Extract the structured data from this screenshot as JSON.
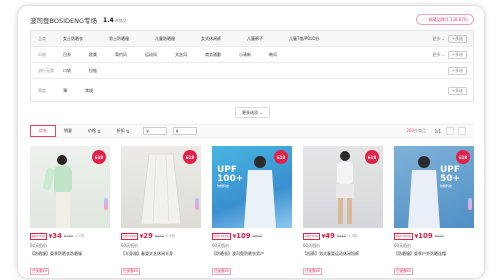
{
  "header": {
    "store_name": "波司登BOSIDENG专场",
    "count": "1.4",
    "count_unit": "件商品",
    "fav_label": "收藏品牌(1,338,876)"
  },
  "filters": [
    {
      "label": "品类",
      "options": [
        "女士防晒衣",
        "男士防晒服",
        "儿童防晒服",
        "女式休闲裤",
        "儿童裤子",
        "儿童T恤/POLO衫"
      ],
      "more": "更多",
      "multi": "多选"
    },
    {
      "label": "风格",
      "options": [
        "日系",
        "欧美",
        "简约风",
        "运动风",
        "文艺风",
        "商务通勤",
        "小清新",
        "韩风"
      ],
      "more": "更多",
      "multi": "多选"
    },
    {
      "label": "流行元素",
      "options": [
        "口袋",
        "拉链"
      ],
      "more": "",
      "multi": "多选"
    },
    {
      "label": "厚度",
      "options": [
        "薄",
        "常规"
      ],
      "more": "",
      "multi": "多选"
    }
  ],
  "more_options": "更多选项",
  "sortbar": {
    "tabs": [
      "综合",
      "销量",
      "价格",
      "折扣"
    ],
    "price_from": "¥",
    "price_to": "¥",
    "result_count": "200",
    "result_suffix": "件商品",
    "page": "1/1"
  },
  "products": [
    {
      "tag": "好价 ¥34",
      "price": "34",
      "orig": "¥159",
      "sold": "1.7折",
      "title": "60天低价",
      "desc": "【防晒服】夏季防晒衣防晒服",
      "coupon": "已优惠¥5"
    },
    {
      "tag": "好价 ¥29",
      "price": "29",
      "orig": "¥469",
      "sold": "0.6折",
      "title": "60天低价",
      "desc": "【半身裙】春夏文艺休闲半身",
      "coupon": "已优惠¥5"
    },
    {
      "tag": "好价 ¥109",
      "price": "109",
      "orig": "¥809",
      "sold": "",
      "title": "60天低价",
      "desc": "【防晒衣】波司登防晒衣男户",
      "coupon": "已优惠¥5"
    },
    {
      "tag": "好价 ¥49",
      "price": "49",
      "orig": "¥369",
      "sold": "1.3折",
      "title": "60天低价",
      "desc": "【短裤】男式春夏运动休闲短裤",
      "coupon": "已优惠¥5"
    },
    {
      "tag": "好价 ¥109",
      "price": "109",
      "orig": "¥339",
      "sold": "",
      "title": "60天低价",
      "desc": "【防晒服】夏季户外防晒连帽",
      "coupon": "已优惠¥5"
    }
  ],
  "upf_a": {
    "big": "UPF",
    "big2": "100+",
    "small": "防晒科技"
  },
  "upf_b": {
    "big": "UPF",
    "big2": "50+",
    "small": "防晒科技"
  },
  "badge": "618"
}
